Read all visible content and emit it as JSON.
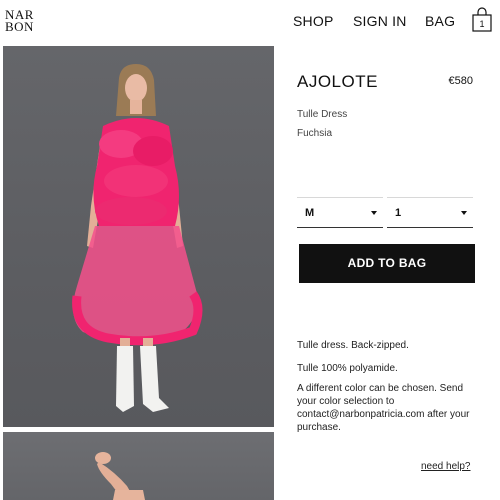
{
  "header": {
    "logo_line1": "NAR",
    "logo_line2": "BON",
    "nav": {
      "shop": "SHOP",
      "sign_in": "SIGN IN",
      "bag": "BAG"
    },
    "bag_count": "1"
  },
  "product": {
    "name": "AJOLOTE",
    "price": "€580",
    "type": "Tulle Dress",
    "color": "Fuchsia",
    "size": {
      "selected": "M"
    },
    "quantity": {
      "selected": "1"
    },
    "add_to_bag_label": "ADD TO BAG",
    "description": {
      "line1": "Tulle dress. Back-zipped.",
      "line2": "Tulle 100% polyamide.",
      "line3": "A different color can be chosen. Send your color selection to contact@narbonpatricia.com after your purchase."
    },
    "help_link": "need help?"
  },
  "icons": {
    "bag": "shopping-bag-icon",
    "caret": "caret-down-icon"
  },
  "colors": {
    "dress": "#ef1f6e",
    "background_photo": "#5f6064",
    "button": "#111111"
  }
}
